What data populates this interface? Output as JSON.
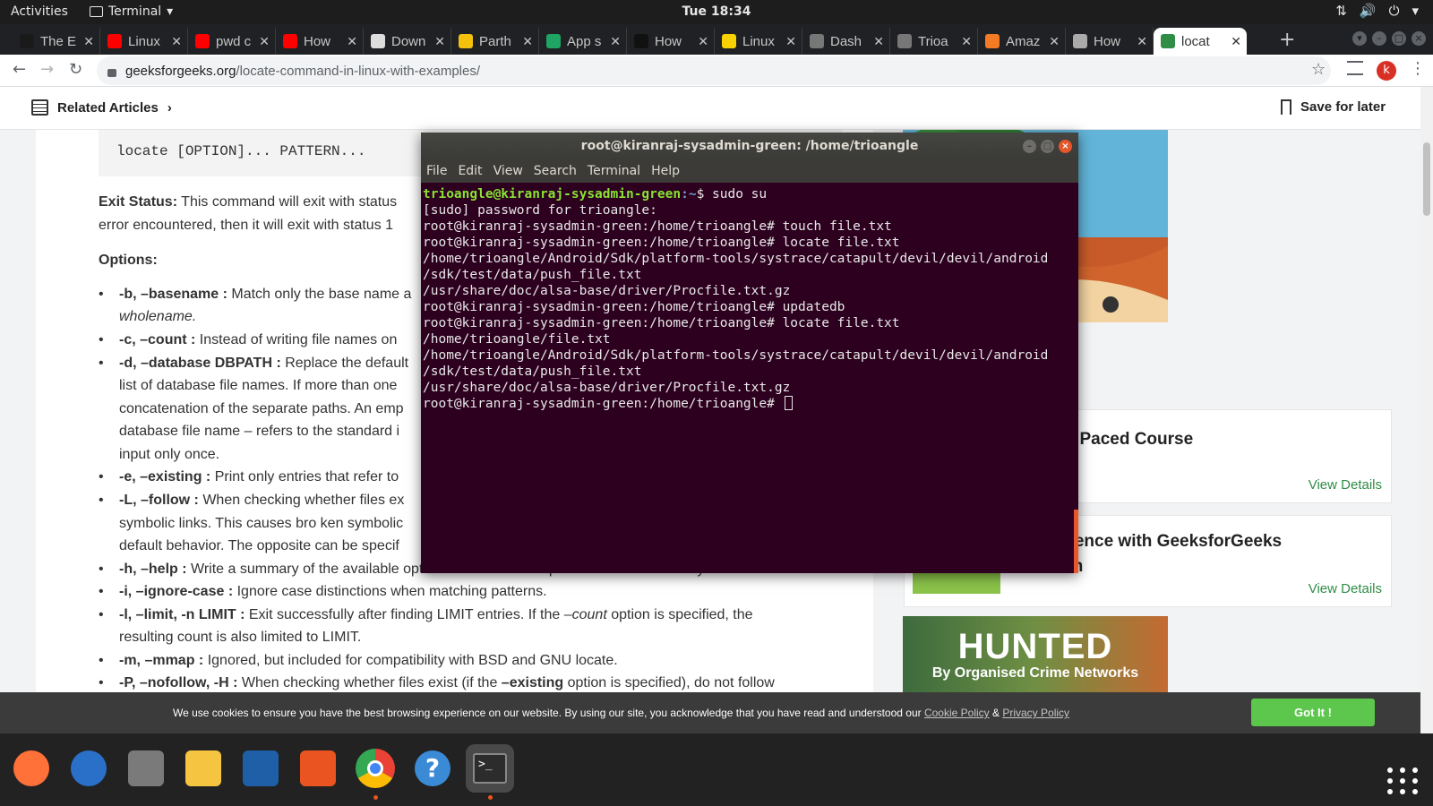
{
  "topbar": {
    "activities": "Activities",
    "app_name": "Terminal",
    "clock": "Tue 18:34"
  },
  "tabs": [
    {
      "title": "The E",
      "favicon_color": "#1a1a1a"
    },
    {
      "title": "Linux",
      "favicon_color": "#ff0000"
    },
    {
      "title": "pwd c",
      "favicon_color": "#ff0000"
    },
    {
      "title": "How ",
      "favicon_color": "#ff0000"
    },
    {
      "title": "Down",
      "favicon_color": "#dddddd"
    },
    {
      "title": "Parth",
      "favicon_color": "#f4c20d"
    },
    {
      "title": "App s",
      "favicon_color": "#1fa463"
    },
    {
      "title": "How ",
      "favicon_color": "#111111"
    },
    {
      "title": "Linux",
      "favicon_color": "#f7d200"
    },
    {
      "title": "Dash",
      "favicon_color": "#777777"
    },
    {
      "title": "Trioa",
      "favicon_color": "#777777"
    },
    {
      "title": "Amaz",
      "favicon_color": "#f57a24"
    },
    {
      "title": "How ",
      "favicon_color": "#aaaaaa"
    },
    {
      "title": "locat",
      "favicon_color": "#2f8d46",
      "active": true
    }
  ],
  "address": {
    "host": "geeksforgeeks.org",
    "path": "/locate-command-in-linux-with-examples/",
    "profile_initial": "k"
  },
  "page": {
    "related": "Related Articles",
    "save_for_later": "Save for later",
    "syntax": "locate [OPTION]... PATTERN...",
    "exit_status_label": "Exit Status:",
    "exit_status_text": " This command will exit with status",
    "exit_status_line2": "error encountered, then it will exit with status 1",
    "options_heading": "Options:",
    "options": [
      {
        "flag": "-b, –basename :",
        "text": " Match only the base name a"
      },
      {
        "flag": "",
        "text": "wholename.",
        "italic": true
      },
      {
        "flag": "-c, –count :",
        "text": " Instead of writing file names on"
      },
      {
        "flag": "-d, –database DBPATH :",
        "text": " Replace the default"
      },
      {
        "flag": "",
        "text": "list of database file names. If more than one"
      },
      {
        "flag": "",
        "text": "concatenation of the separate paths. An emp"
      },
      {
        "flag": "",
        "text": "database file name – refers to the standard i"
      },
      {
        "flag": "",
        "text": "input only once."
      },
      {
        "flag": "-e, –existing :",
        "text": " Print only entries that refer to"
      },
      {
        "flag": "-L, –follow :",
        "text": " When checking whether files ex"
      },
      {
        "flag": "",
        "text": "symbolic links. This causes bro ken symbolic"
      },
      {
        "flag": "",
        "text": "default behavior. The opposite can be specif"
      },
      {
        "flag": "-h, –help :",
        "text": " Write a summary of the available options to standard output and exit successfully."
      },
      {
        "flag": "-i, –ignore-case :",
        "text": " Ignore case distinctions when matching patterns."
      },
      {
        "flag": "-l, –limit, -n LIMIT :",
        "text": " Exit successfully after finding LIMIT entries. If the ",
        "italic_tail": "–count",
        "tail": " option is specified, the"
      },
      {
        "flag": "",
        "text": "resulting count is also limited to LIMIT."
      },
      {
        "flag": "-m, –mmap :",
        "text": " Ignored, but included for compatibility with BSD and GNU locate."
      },
      {
        "flag": "-P, –nofollow, -H :",
        "text": " When checking whether files exist (if the ",
        "bold_tail": "–existing",
        "tail": " option is specified), do not follow"
      }
    ],
    "card1_title": "elf Paced Course",
    "card1_link": "View Details",
    "card2_title1": "e experience with GeeksforGeeks",
    "card2_title2": "Premium",
    "card2_link": "View Details",
    "ad_label": "Ad",
    "hunted_title": "HUNTED",
    "hunted_sub": "By Organised Crime Networks"
  },
  "cookie": {
    "text": "We use cookies to ensure you have the best browsing experience on our website. By using our site, you acknowledge that you have read and understood our ",
    "policy": "Cookie Policy",
    "amp": " & ",
    "privacy": "Privacy Policy",
    "button": "Got It !"
  },
  "terminal": {
    "title": "root@kiranraj-sysadmin-green: /home/trioangle",
    "menu": [
      "File",
      "Edit",
      "View",
      "Search",
      "Terminal",
      "Help"
    ],
    "user_prompt_user": "trioangle@kiranraj-sysadmin-green",
    "user_prompt_path": ":~",
    "user_prompt_cmd": "$ sudo su",
    "lines": [
      "[sudo] password for trioangle:",
      "root@kiranraj-sysadmin-green:/home/trioangle# touch file.txt",
      "root@kiranraj-sysadmin-green:/home/trioangle# locate file.txt",
      "/home/trioangle/Android/Sdk/platform-tools/systrace/catapult/devil/devil/android",
      "/sdk/test/data/push_file.txt",
      "/usr/share/doc/alsa-base/driver/Procfile.txt.gz",
      "root@kiranraj-sysadmin-green:/home/trioangle# updatedb",
      "root@kiranraj-sysadmin-green:/home/trioangle# locate file.txt",
      "/home/trioangle/file.txt",
      "/home/trioangle/Android/Sdk/platform-tools/systrace/catapult/devil/devil/android",
      "/sdk/test/data/push_file.txt",
      "/usr/share/doc/alsa-base/driver/Procfile.txt.gz"
    ],
    "final_prompt": "root@kiranraj-sysadmin-green:/home/trioangle# "
  },
  "dock": [
    {
      "name": "firefox",
      "color": "#ff7139"
    },
    {
      "name": "thunderbird",
      "color": "#2a70c8"
    },
    {
      "name": "files",
      "color": "#7a7a7a"
    },
    {
      "name": "rhythmbox",
      "color": "#f5c542"
    },
    {
      "name": "libreoffice-writer",
      "color": "#1f5fa8"
    },
    {
      "name": "ubuntu-software",
      "color": "#e95420"
    },
    {
      "name": "chrome",
      "color": "#4285f4"
    },
    {
      "name": "help",
      "color": "#3a8ad6"
    },
    {
      "name": "terminal",
      "color": "#2c2c2c"
    }
  ]
}
